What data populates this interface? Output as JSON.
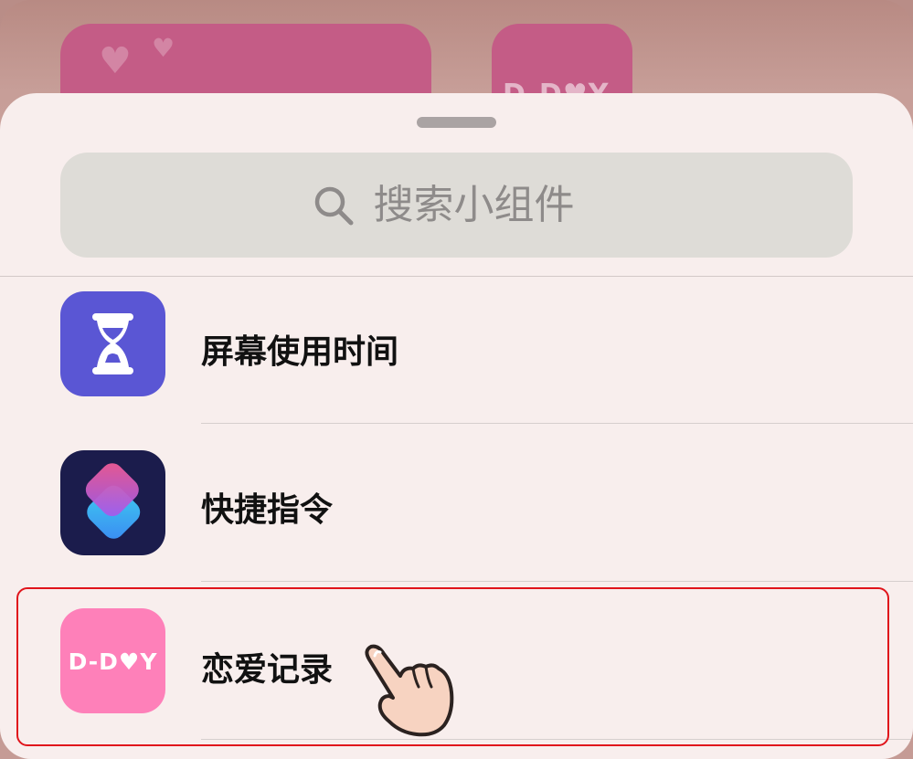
{
  "search": {
    "placeholder": "搜索小组件"
  },
  "widgets": [
    {
      "name": "屏幕使用时间",
      "icon": "hourglass-icon",
      "color": "#5a56d4"
    },
    {
      "name": "快捷指令",
      "icon": "shortcuts-icon",
      "color": "#1b1c4c"
    },
    {
      "name": "恋爱记录",
      "icon": "dday-icon",
      "color": "#fe80b9",
      "icon_text": "D-D♥Y",
      "highlighted": true
    }
  ],
  "colors": {
    "sheet": "#f8eeed",
    "highlight": "#e0141b",
    "background_widget": "#c45c86"
  }
}
